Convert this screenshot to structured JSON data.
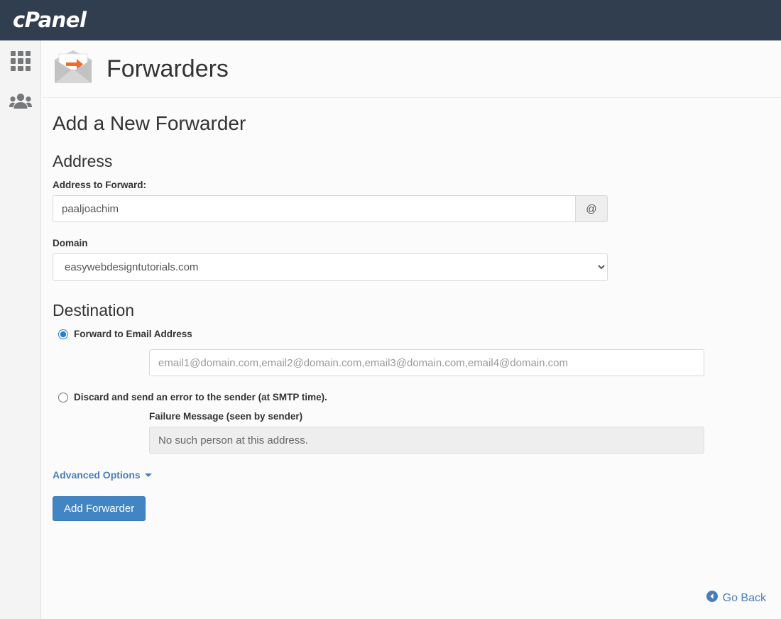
{
  "topbar": {
    "logo_text": "cPanel",
    "logo_icon": "cpanel-logo"
  },
  "sidebar": {
    "items": [
      {
        "icon": "grid-apps-icon",
        "name": "apps"
      },
      {
        "icon": "users-group-icon",
        "name": "user-manager"
      }
    ]
  },
  "page": {
    "icon": "forwarders-envelope-icon",
    "title": "Forwarders",
    "section_title": "Add a New Forwarder"
  },
  "address": {
    "group_title": "Address",
    "address_label": "Address to Forward:",
    "address_value": "paaljoachim",
    "address_placeholder": "",
    "at_symbol": "@",
    "domain_label": "Domain",
    "domain_selected": "easywebdesigntutorials.com",
    "domain_options": [
      "easywebdesigntutorials.com"
    ]
  },
  "destination": {
    "group_title": "Destination",
    "forward_radio_label": "Forward to Email Address",
    "forward_radio_selected": true,
    "email_value": "",
    "email_placeholder": "email1@domain.com,email2@domain.com,email3@domain.com,email4@domain.com",
    "discard_radio_label": "Discard and send an error to the sender (at SMTP time).",
    "discard_radio_selected": false,
    "failure_label": "Failure Message (seen by sender)",
    "failure_value": "No such person at this address."
  },
  "actions": {
    "advanced_options_label": "Advanced Options",
    "advanced_caret_icon": "chevron-down-icon",
    "submit_label": "Add Forwarder",
    "go_back_label": "Go Back",
    "go_back_icon": "arrow-circle-left-icon"
  },
  "colors": {
    "topbar_bg": "#303e50",
    "accent_blue": "#4285c4",
    "link_blue": "#4a7ebb",
    "icon_grey": "#77787a",
    "envelope_arrow_orange": "#ef6c2e"
  }
}
